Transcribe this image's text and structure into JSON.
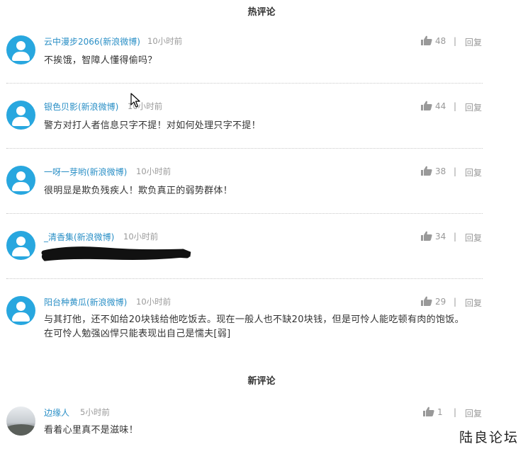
{
  "hot_title": "热评论",
  "new_title": "新评论",
  "hot_comments": [
    {
      "author": "云中漫步2066(新浪微博)",
      "time": "10小时前",
      "text": "不挨饿，智障人懂得偷吗？",
      "likes": "48",
      "sep": "|",
      "reply": "回复"
    },
    {
      "author": "银色贝影(新浪微博)",
      "time": "10小时前",
      "text": "警方对打人者信息只字不提！对如何处理只字不提！",
      "likes": "44",
      "sep": "|",
      "reply": "回复"
    },
    {
      "author": "一呀一芽哟(新浪微博)",
      "time": "10小时前",
      "text": "很明显是欺负残疾人！欺负真正的弱势群体！",
      "likes": "38",
      "sep": "|",
      "reply": "回复"
    },
    {
      "author": "_清香集(新浪微博)",
      "time": "10小时前",
      "text": "",
      "likes": "34",
      "sep": "|",
      "reply": "回复"
    },
    {
      "author": "阳台种黄瓜(新浪微博)",
      "time": "10小时前",
      "text": "与其打他，还不如给20块钱给他吃饭去。现在一般人也不缺20块钱，但是可怜人能吃顿有肉的饱饭。在可怜人勉强凶悍只能表现出自己是懦夫[弱]",
      "likes": "29",
      "sep": "|",
      "reply": "回复"
    }
  ],
  "new_comments": [
    {
      "author": "边缘人",
      "time": "5小时前",
      "text": "看着心里真不是滋味！",
      "likes": "1",
      "sep": "|",
      "reply": "回复"
    }
  ],
  "watermark": "陆良论坛",
  "colors": {
    "accent": "#28a7df",
    "author": "#2a8fc6",
    "muted": "#999999"
  },
  "icons": {
    "thumb": "thumbs-up-icon",
    "avatar": "default-user-icon",
    "cursor": "mouse-pointer-icon"
  }
}
